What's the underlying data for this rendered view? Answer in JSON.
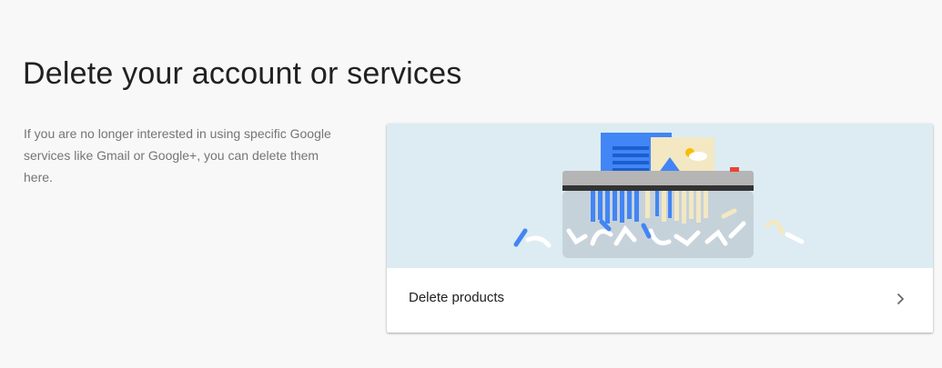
{
  "page": {
    "title": "Delete your account or services",
    "description": "If you are no longer interested in using specific Google services like Gmail or Google+, you can delete them here."
  },
  "card": {
    "illustration": "paper-shredder-illustration",
    "action_label": "Delete products",
    "action_icon": "chevron-right-icon"
  },
  "colors": {
    "page_background": "#f8f8f8",
    "banner_background": "#dcecf2",
    "google_blue": "#4285f4",
    "paper_cream": "#f3e8c2",
    "shredder_gray": "#9e9e9e",
    "shredder_dark": "#212121",
    "alert_red": "#ea4335",
    "sun_yellow": "#fbbc05"
  }
}
